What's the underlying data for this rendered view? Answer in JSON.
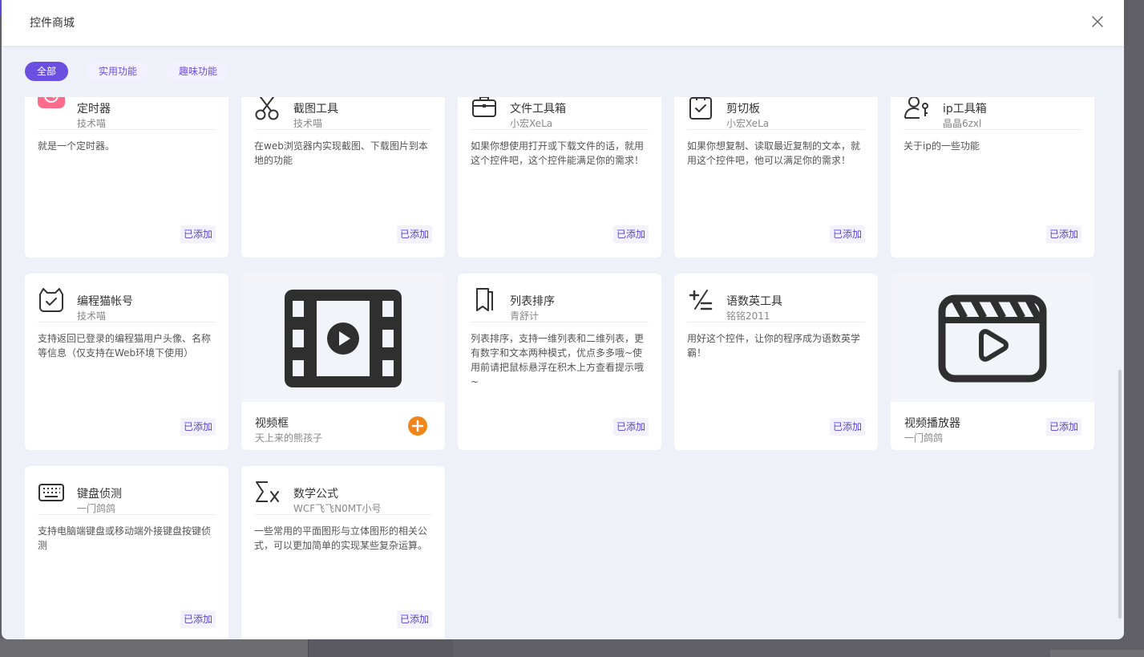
{
  "dialog": {
    "title": "控件商城",
    "close_label": "×"
  },
  "filters": [
    {
      "label": "全部",
      "active": true
    },
    {
      "label": "实用功能",
      "active": false
    },
    {
      "label": "趣味功能",
      "active": false
    }
  ],
  "cards": [
    {
      "title": "定时器",
      "author": "技术喵",
      "desc": "就是一个定时器。",
      "status": "已添加",
      "icon": "alarm-clock-icon"
    },
    {
      "title": "截图工具",
      "author": "技术喵",
      "desc": "在web浏览器内实现截图、下载图片到本地的功能",
      "status": "已添加",
      "icon": "scissors-icon"
    },
    {
      "title": "文件工具箱",
      "author": "小宏XeLa",
      "desc": "如果你想使用打开或下载文件的话，就用这个控件吧，这个控件能满足你的需求！",
      "status": "已添加",
      "icon": "briefcase-icon"
    },
    {
      "title": "剪切板",
      "author": "小宏XeLa",
      "desc": "如果你想复制、读取最近复制的文本，就用这个控件吧，他可以满足你的需求！",
      "status": "已添加",
      "icon": "clipboard-check-icon"
    },
    {
      "title": "ip工具箱",
      "author": "晶晶6zxl",
      "desc": "关于ip的一些功能",
      "status": "已添加",
      "icon": "user-key-icon"
    },
    {
      "title": "编程猫帐号",
      "author": "技术喵",
      "desc": "支持返回已登录的编程猫用户头像、名称等信息（仅支持在Web环境下使用）",
      "status": "已添加",
      "icon": "cat-check-icon"
    },
    {
      "title": "视频框",
      "author": "天上来的熊孩子",
      "status": "+",
      "icon": "film-play-icon"
    },
    {
      "title": "列表排序",
      "author": "青舒计",
      "desc": "列表排序，支持一维列表和二维列表，更有数字和文本两种模式，优点多多哦~使用前请把鼠标悬浮在积木上方查看提示哦~",
      "status": "已添加",
      "icon": "bookmarks-icon"
    },
    {
      "title": "语数英工具",
      "author": "铭铭2011",
      "desc": "用好这个控件，让你的程序成为语数英学霸！",
      "status": "已添加",
      "icon": "plus-minus-icon"
    },
    {
      "title": "视频播放器",
      "author": "一门鸽鸽",
      "status": "已添加",
      "icon": "clapperboard-icon"
    },
    {
      "title": "键盘侦测",
      "author": "一门鸽鸽",
      "desc": "支持电脑端键盘或移动端外接键盘按键侦测",
      "status": "已添加",
      "icon": "keyboard-icon"
    },
    {
      "title": "数学公式",
      "author": "WCF飞飞N0MT小号",
      "desc": "一些常用的平面图形与立体图形的相关公式，可以更加简单的实现某些复杂运算。",
      "status": "已添加",
      "icon": "sigma-x-icon"
    }
  ]
}
